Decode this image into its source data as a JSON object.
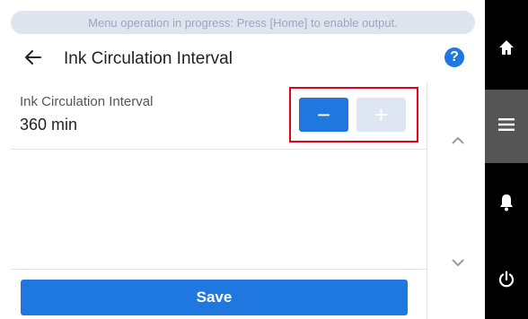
{
  "status_banner": "Menu operation in progress: Press [Home] to enable output.",
  "header": {
    "title": "Ink Circulation Interval",
    "help_glyph": "?"
  },
  "setting": {
    "label": "Ink Circulation Interval",
    "value": "360 min",
    "minus_glyph": "−",
    "plus_glyph": "+"
  },
  "save_button": "Save",
  "sidebar": {
    "items": [
      "home-icon",
      "menu-icon",
      "bell-icon",
      "power-icon"
    ],
    "active": "menu-icon"
  },
  "colors": {
    "accent": "#1f77e0",
    "highlight_frame": "#e0001a",
    "sidebar_bg": "#000000",
    "sidebar_active_bg": "#555555"
  }
}
